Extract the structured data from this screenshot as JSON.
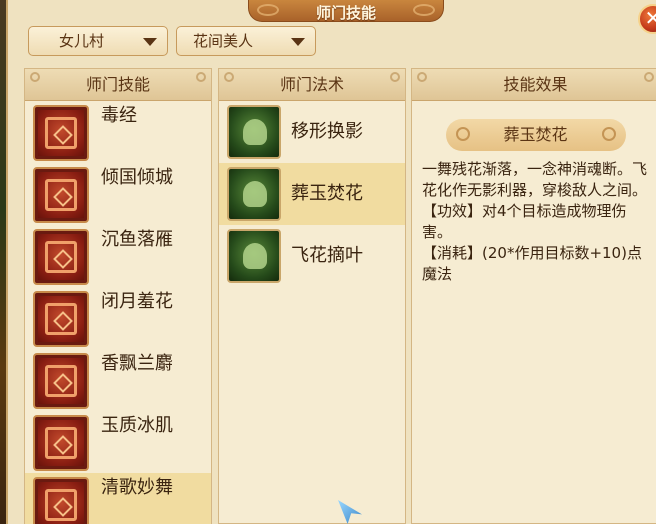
{
  "window": {
    "title": "师门技能"
  },
  "dropdowns": {
    "sect": "女儿村",
    "master": "花间美人"
  },
  "panels": {
    "skills_header": "师门技能",
    "spells_header": "师门法术",
    "effect_header": "技能效果"
  },
  "skills": [
    {
      "name": "毒经",
      "icon": "poison-book-icon"
    },
    {
      "name": "倾国倾城",
      "icon": "charm-icon"
    },
    {
      "name": "沉鱼落雁",
      "icon": "fish-goose-icon"
    },
    {
      "name": "闭月羞花",
      "icon": "moon-flower-icon"
    },
    {
      "name": "香飘兰麝",
      "icon": "fragrance-icon"
    },
    {
      "name": "玉质冰肌",
      "icon": "jade-skin-icon"
    },
    {
      "name": "清歌妙舞",
      "icon": "dance-icon"
    }
  ],
  "spells": [
    {
      "name": "移形换影",
      "icon": "shadow-swap-icon"
    },
    {
      "name": "葬玉焚花",
      "icon": "burning-flower-icon"
    },
    {
      "name": "飞花摘叶",
      "icon": "flying-leaf-icon"
    }
  ],
  "effect": {
    "title": "葬玉焚花",
    "description": "一舞残花渐落，一念神消魂断。飞花化作无影利器，穿梭敌人之间。",
    "effect_line": "【功效】对4个目标造成物理伤害。",
    "cost_line": "【消耗】(20*作用目标数+10)点魔法"
  },
  "colors": {
    "selected_row": "#f1dca0",
    "panel_bg": "#f6ecd2",
    "title_bar": "#b8723a"
  }
}
